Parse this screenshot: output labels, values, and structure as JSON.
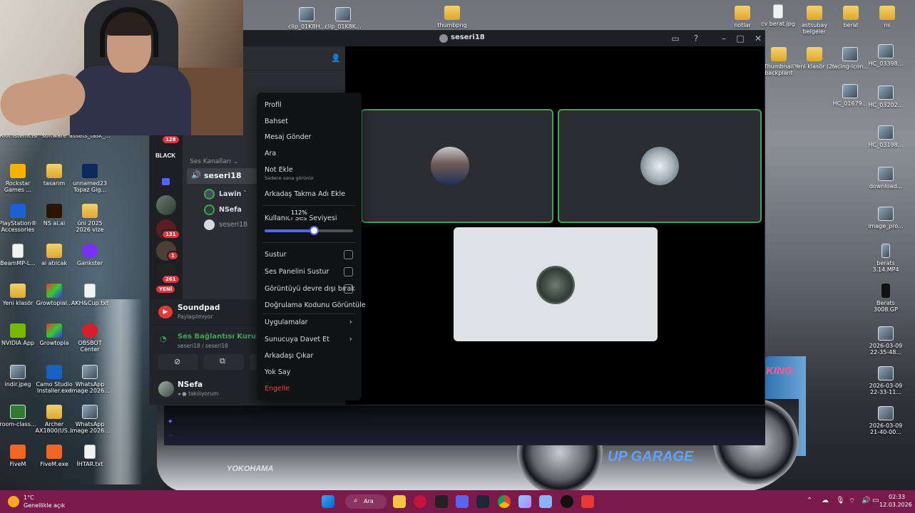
{
  "desktop": {
    "top_icons": [
      {
        "label": "clip_01K8H..."
      },
      {
        "label": "clip_01K8K..."
      },
      {
        "label": "thumbpng"
      },
      {
        "label": "notlar"
      },
      {
        "label": "cv berat.jpg"
      },
      {
        "label": "astsubay belgeler"
      },
      {
        "label": "berat"
      },
      {
        "label": "ns"
      }
    ],
    "left_icons": [
      {
        "label": "Riot İstemcisi"
      },
      {
        "label": "software"
      },
      {
        "label": "assets_task_..."
      },
      {
        "label": "Rockstar Games ..."
      },
      {
        "label": "tasarım"
      },
      {
        "label": "unnamed23 Topaz Gig..."
      },
      {
        "label": "PlayStation® Accessories"
      },
      {
        "label": "NS ai.ai"
      },
      {
        "label": "üni 2025 2026 vize"
      },
      {
        "label": "BeamMP-L..."
      },
      {
        "label": "ai atılcak"
      },
      {
        "label": "Gankster"
      },
      {
        "label": "Yeni klasör"
      },
      {
        "label": "Growtopial..."
      },
      {
        "label": "AKH&Cup.txt"
      },
      {
        "label": "NVIDIA App"
      },
      {
        "label": "Growtopia"
      },
      {
        "label": "OBSBOT Center"
      },
      {
        "label": "indir.jpeg"
      },
      {
        "label": "Camo Studio Installer.exe"
      },
      {
        "label": "WhatsApp Image 2026..."
      },
      {
        "label": "room-class..."
      },
      {
        "label": "Archer AX1800(US..."
      },
      {
        "label": "WhatsApp Image 2026..."
      },
      {
        "label": "FiveM"
      },
      {
        "label": "FiveM.exe"
      },
      {
        "label": "İHTAR.txt"
      }
    ],
    "right_icons": [
      {
        "label": "Thumbnail backplant"
      },
      {
        "label": "Yeni klasör (2)"
      },
      {
        "label": "racing-icon..."
      },
      {
        "label": "HC_03398..."
      },
      {
        "label": "HC_01679..."
      },
      {
        "label": "HC_03202..."
      },
      {
        "label": "HC_03198..."
      },
      {
        "label": "download..."
      },
      {
        "label": "image_pro..."
      },
      {
        "label": "berats 3.14.MP4"
      },
      {
        "label": "Berats 3008.GP"
      },
      {
        "label": "2026-03-09 22-35-48..."
      },
      {
        "label": "2026-03-09 22-33-11..."
      },
      {
        "label": "2026-03-09 21-40-00..."
      }
    ],
    "wallpaper_text": [
      "YOKOHAMA",
      "UP GARAGE",
      "KING"
    ]
  },
  "discord": {
    "window_title": "seseri18",
    "servers": {
      "badges": [
        "128",
        "131",
        "1",
        "261"
      ],
      "black_label": "BLACK",
      "new_label": "YENİ"
    },
    "channels": {
      "category": "Ses Kanalları",
      "voice_channel": "seseri18",
      "members": [
        "Lawin `",
        "NSefa",
        "seseri18"
      ]
    },
    "soundpad": {
      "title": "Soundpad",
      "subtitle": "Paylaşılmıyor"
    },
    "voice_status": {
      "title": "Ses Bağlantısı Kuruldu",
      "subtitle": "seseri18 / seseri18"
    },
    "user": {
      "name": "NSefa",
      "status": "takılıyorum"
    },
    "menu": {
      "items": [
        "Profil",
        "Bahset",
        "Mesaj Gönder",
        "Ara",
        "Not Ekle",
        "Arkadaş Takma Adı Ekle"
      ],
      "note_sub": "Sadece sana görünür",
      "volume_label": "Kullanıcı Ses Seviyesi",
      "volume_value": 112,
      "volume_max": 200,
      "volume_tooltip": "112%",
      "checks": [
        "Sustur",
        "Ses Panelini Sustur",
        "Görüntüyü devre dışı bırak"
      ],
      "verify": "Doğrulama Kodunu Görüntüle",
      "apps": "Uygulamalar",
      "invite": "Sunucuya Davet Et",
      "remove": "Arkadaşı Çıkar",
      "ignore": "Yok Say",
      "block": "Engelle"
    },
    "colors": {
      "accent": "#5865f2",
      "speaking": "#3ba55d",
      "danger": "#f23f43"
    }
  },
  "taskbar": {
    "weather_temp": "1°C",
    "weather_desc": "Genellikle açık",
    "search": "Ara",
    "time": "02:33",
    "date": "12.03.2026"
  }
}
